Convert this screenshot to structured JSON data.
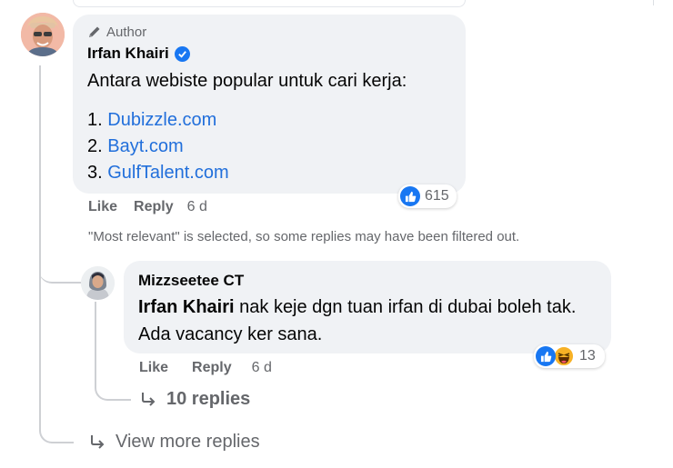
{
  "comment": {
    "badge": "Author",
    "author": "Irfan Khairi",
    "text": "Antara webiste popular untuk cari kerja:",
    "list": [
      "1. ",
      "Dubizzle.com",
      "2. ",
      "Bayt.com",
      "3. ",
      "GulfTalent.com"
    ],
    "reaction_count": "615",
    "like_label": "Like",
    "reply_label": "Reply",
    "time": "6 d",
    "filter_note": "\"Most relevant\" is selected, so some replies may have been filtered out."
  },
  "reply": {
    "author": "Mizzseetee CT",
    "mention": "Irfan Khairi",
    "text": " nak keje dgn tuan irfan di dubai boleh tak. Ada vacancy ker sana.",
    "reaction_count": "13",
    "like_label": "Like",
    "reply_label": "Reply",
    "time": "6 d",
    "more_replies": "10 replies"
  },
  "view_more": "View more replies",
  "colors": {
    "link": "#216fdb",
    "verified": "#1877f2",
    "bubble": "#f0f2f5",
    "muted": "#65676b"
  }
}
